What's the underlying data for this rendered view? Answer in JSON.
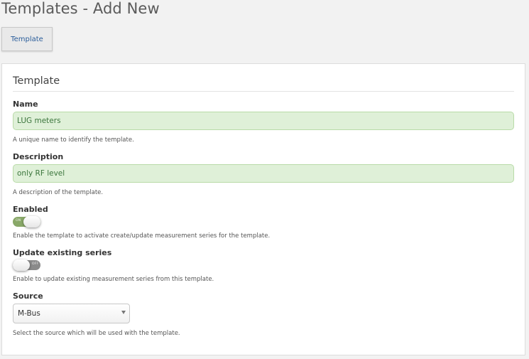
{
  "header": {
    "title": "Templates - Add New"
  },
  "tabs": [
    {
      "label": "Template",
      "active": true
    }
  ],
  "section": {
    "title": "Template"
  },
  "fields": {
    "name": {
      "label": "Name",
      "value": "LUG meters",
      "help": "A unique name to identify the template."
    },
    "description": {
      "label": "Description",
      "value": "only RF level",
      "help": "A description of the template."
    },
    "enabled": {
      "label": "Enabled",
      "checked": true,
      "help": "Enable the template to activate create/update measurement series for the template."
    },
    "update_existing": {
      "label": "Update existing series",
      "checked": false,
      "help": "Enable to update existing measurement series from this template."
    },
    "source": {
      "label": "Source",
      "selected": "M-Bus",
      "help": "Select the source which will be used with the template."
    }
  },
  "colors": {
    "valid_field_bg": "#dff0d8",
    "valid_field_text": "#3c763d",
    "toggle_on": "#89a868",
    "toggle_off": "#8a8a8a",
    "tab_text": "#2a5d9a"
  },
  "icons": {
    "select_caret": "chevron-down-icon"
  }
}
